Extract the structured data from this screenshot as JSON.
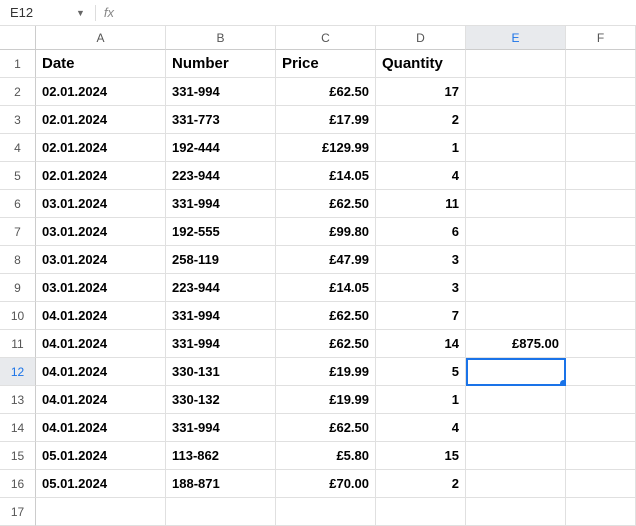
{
  "nameBox": "E12",
  "fxLabel": "fx",
  "columns": [
    "A",
    "B",
    "C",
    "D",
    "E",
    "F"
  ],
  "selectedCol": "E",
  "selectedRow": 12,
  "rowNumbers": [
    1,
    2,
    3,
    4,
    5,
    6,
    7,
    8,
    9,
    10,
    11,
    12,
    13,
    14,
    15,
    16,
    17
  ],
  "headers": {
    "A": "Date",
    "B": "Number",
    "C": "Price",
    "D": "Quantity",
    "E": ""
  },
  "rows": [
    {
      "A": "02.01.2024",
      "B": "331-994",
      "C": "£62.50",
      "D": "17",
      "E": ""
    },
    {
      "A": "02.01.2024",
      "B": "331-773",
      "C": "£17.99",
      "D": "2",
      "E": ""
    },
    {
      "A": "02.01.2024",
      "B": "192-444",
      "C": "£129.99",
      "D": "1",
      "E": ""
    },
    {
      "A": "02.01.2024",
      "B": "223-944",
      "C": "£14.05",
      "D": "4",
      "E": ""
    },
    {
      "A": "03.01.2024",
      "B": "331-994",
      "C": "£62.50",
      "D": "11",
      "E": ""
    },
    {
      "A": "03.01.2024",
      "B": "192-555",
      "C": "£99.80",
      "D": "6",
      "E": ""
    },
    {
      "A": "03.01.2024",
      "B": "258-119",
      "C": "£47.99",
      "D": "3",
      "E": ""
    },
    {
      "A": "03.01.2024",
      "B": "223-944",
      "C": "£14.05",
      "D": "3",
      "E": ""
    },
    {
      "A": "04.01.2024",
      "B": "331-994",
      "C": "£62.50",
      "D": "7",
      "E": ""
    },
    {
      "A": "04.01.2024",
      "B": "331-994",
      "C": "£62.50",
      "D": "14",
      "E": "£875.00"
    },
    {
      "A": "04.01.2024",
      "B": "330-131",
      "C": "£19.99",
      "D": "5",
      "E": ""
    },
    {
      "A": "04.01.2024",
      "B": "330-132",
      "C": "£19.99",
      "D": "1",
      "E": ""
    },
    {
      "A": "04.01.2024",
      "B": "331-994",
      "C": "£62.50",
      "D": "4",
      "E": ""
    },
    {
      "A": "05.01.2024",
      "B": "113-862",
      "C": "£5.80",
      "D": "15",
      "E": ""
    },
    {
      "A": "05.01.2024",
      "B": "188-871",
      "C": "£70.00",
      "D": "2",
      "E": ""
    },
    {
      "A": "",
      "B": "",
      "C": "",
      "D": "",
      "E": ""
    }
  ],
  "chart_data": {
    "type": "table",
    "title": "",
    "columns": [
      "Date",
      "Number",
      "Price",
      "Quantity"
    ],
    "rows": [
      [
        "02.01.2024",
        "331-994",
        "£62.50",
        17
      ],
      [
        "02.01.2024",
        "331-773",
        "£17.99",
        2
      ],
      [
        "02.01.2024",
        "192-444",
        "£129.99",
        1
      ],
      [
        "02.01.2024",
        "223-944",
        "£14.05",
        4
      ],
      [
        "03.01.2024",
        "331-994",
        "£62.50",
        11
      ],
      [
        "03.01.2024",
        "192-555",
        "£99.80",
        6
      ],
      [
        "03.01.2024",
        "258-119",
        "£47.99",
        3
      ],
      [
        "03.01.2024",
        "223-944",
        "£14.05",
        3
      ],
      [
        "04.01.2024",
        "331-994",
        "£62.50",
        7
      ],
      [
        "04.01.2024",
        "331-994",
        "£62.50",
        14
      ],
      [
        "04.01.2024",
        "330-131",
        "£19.99",
        5
      ],
      [
        "04.01.2024",
        "330-132",
        "£19.99",
        1
      ],
      [
        "04.01.2024",
        "331-994",
        "£62.50",
        4
      ],
      [
        "05.01.2024",
        "113-862",
        "£5.80",
        15
      ],
      [
        "05.01.2024",
        "188-871",
        "£70.00",
        2
      ]
    ],
    "E11": "£875.00"
  }
}
